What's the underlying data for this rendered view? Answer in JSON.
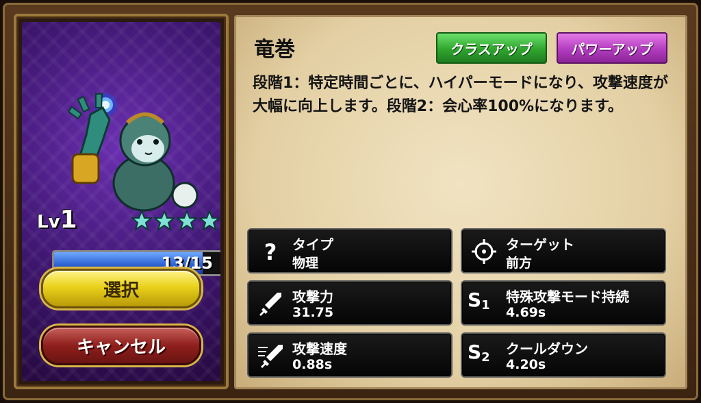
{
  "hero": {
    "level_prefix": "Lv",
    "level": "1",
    "stars": 4,
    "xp_text": "13/15",
    "xp_fraction": 0.8667
  },
  "buttons": {
    "select": "選択",
    "cancel": "キャンセル",
    "class_up": "クラスアップ",
    "power_up": "パワーアップ"
  },
  "skill": {
    "name": "竜巻",
    "description": "段階1：特定時間ごとに、ハイパーモードになり、攻撃速度が大幅に向上します。段階2：会心率100%になります。"
  },
  "stats": [
    {
      "label": "タイプ",
      "value": "物理",
      "icon": "question-icon"
    },
    {
      "label": "ターゲット",
      "value": "前方",
      "icon": "crosshair-icon"
    },
    {
      "label": "攻撃力",
      "value": "31.75",
      "icon": "sword-icon"
    },
    {
      "label": "特殊攻撃モード持続",
      "value": "4.69s",
      "icon": "s1-icon"
    },
    {
      "label": "攻撃速度",
      "value": "0.88s",
      "icon": "fast-sword-icon"
    },
    {
      "label": "クールダウン",
      "value": "4.20s",
      "icon": "s2-icon"
    }
  ],
  "colors": {
    "card_purple": "#3e1670",
    "xp_blue": "#2a5fd0",
    "select_yellow": "#e9d21a",
    "cancel_red": "#8e1f1c",
    "class_green": "#2fa52e",
    "power_purple": "#b23cbf",
    "star_teal": "#7fe0d6"
  }
}
